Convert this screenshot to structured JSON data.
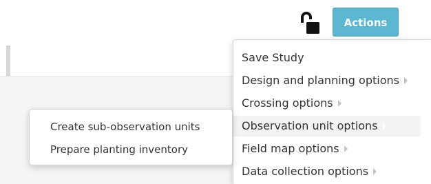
{
  "header": {
    "lock_icon": "unlocked-padlock-icon",
    "actions_label": "Actions",
    "actions_color": "#5cb7d2"
  },
  "actions_menu": {
    "items": [
      {
        "label": "Save Study",
        "has_submenu": false
      },
      {
        "label": "Design and planning options",
        "has_submenu": true
      },
      {
        "label": "Crossing options",
        "has_submenu": true
      },
      {
        "label": "Observation unit options",
        "has_submenu": true,
        "highlighted": true
      },
      {
        "label": "Field map options",
        "has_submenu": true
      },
      {
        "label": "Data collection options",
        "has_submenu": true
      }
    ]
  },
  "observation_unit_submenu": {
    "items": [
      {
        "label": "Create sub-observation units"
      },
      {
        "label": "Prepare planting inventory"
      }
    ]
  }
}
